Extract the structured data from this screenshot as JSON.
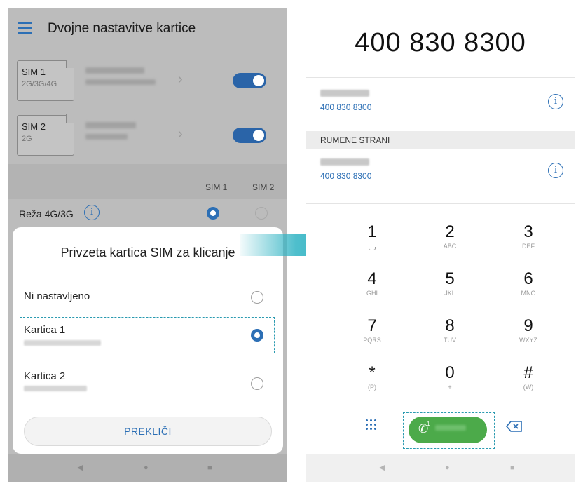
{
  "left": {
    "title": "Dvojne nastavitve kartice",
    "sims": [
      {
        "name": "SIM 1",
        "network": "2G/3G/4G"
      },
      {
        "name": "SIM 2",
        "network": "2G"
      }
    ],
    "col_sim1": "SIM 1",
    "col_sim2": "SIM 2",
    "network_label": "Reža 4G/3G",
    "info_glyph": "i",
    "dialog": {
      "title": "Privzeta kartica SIM za klicanje",
      "options": [
        "Ni nastavljeno",
        "Kartica 1",
        "Kartica 2"
      ],
      "selected": "Kartica 1",
      "cancel": "PREKLIČI"
    }
  },
  "right": {
    "number": "400 830 8300",
    "contacts": [
      {
        "number": "400 830 8300"
      },
      {
        "number": "400 830 8300"
      }
    ],
    "section_header": "RUMENE STRANI",
    "keys": [
      {
        "digit": "1",
        "letters": ""
      },
      {
        "digit": "2",
        "letters": "ABC"
      },
      {
        "digit": "3",
        "letters": "DEF"
      },
      {
        "digit": "4",
        "letters": "GHI"
      },
      {
        "digit": "5",
        "letters": "JKL"
      },
      {
        "digit": "6",
        "letters": "MNO"
      },
      {
        "digit": "7",
        "letters": "PQRS"
      },
      {
        "digit": "8",
        "letters": "TUV"
      },
      {
        "digit": "9",
        "letters": "WXYZ"
      },
      {
        "digit": "*",
        "letters": "(P)"
      },
      {
        "digit": "0",
        "letters": "+"
      },
      {
        "digit": "#",
        "letters": "(W)"
      }
    ],
    "call_sim_indicator": "1"
  },
  "nav": {
    "back": "◀",
    "home": "●",
    "recent": "■"
  },
  "colors": {
    "accent": "#2c6fb5",
    "call_green": "#4caa4a",
    "highlight_dash": "#2a9ab0",
    "arrow": "#2fb3c3"
  },
  "icons": [
    "menu-icon",
    "chevron-right-icon",
    "info-icon",
    "dialpad-icon",
    "phone-icon",
    "backspace-icon"
  ]
}
